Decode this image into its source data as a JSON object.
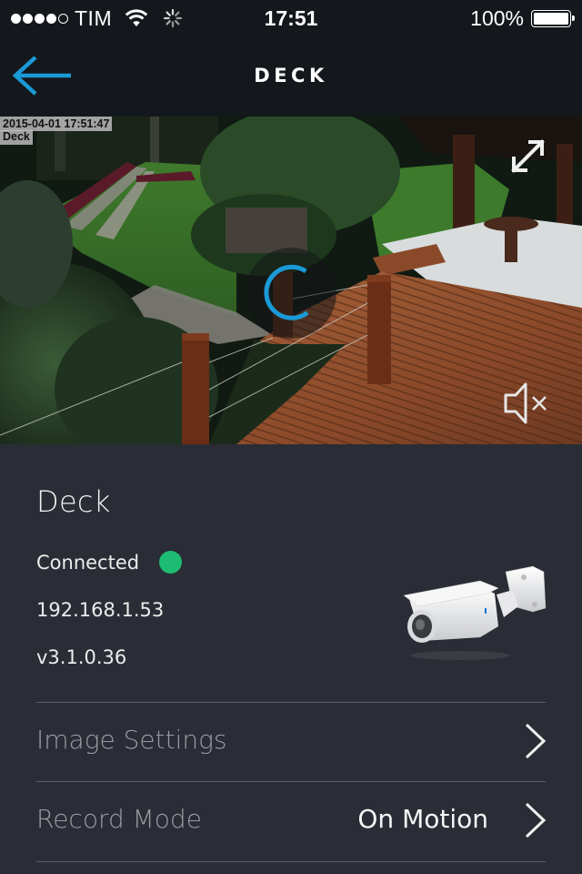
{
  "status_bar": {
    "signal_bars_filled": 4,
    "signal_bars_total": 5,
    "carrier": "TIM",
    "wifi_icon": "wifi-icon",
    "activity_icon": "activity-spinner-icon",
    "time": "17:51",
    "battery_percent": "100%",
    "battery_level": 1.0
  },
  "nav": {
    "title": "DECK",
    "back_icon": "arrow-left-icon"
  },
  "feed": {
    "timestamp": "2015-04-01 17:51:47",
    "camera_label": "Deck",
    "expand_icon": "expand-arrows-icon",
    "mute_icon": "speaker-muted-icon",
    "loading_icon": "loading-spinner-icon"
  },
  "details": {
    "name": "Deck",
    "status": "Connected",
    "ip": "192.168.1.53",
    "version": "v3.1.0.36",
    "camera_image": "bullet-camera-image"
  },
  "menu": [
    {
      "label": "Image Settings",
      "value": ""
    },
    {
      "label": "Record Mode",
      "value": "On Motion"
    }
  ],
  "colors": {
    "accent": "#1a9ad6",
    "status_connected": "#1dbc72",
    "panel_bg": "#2a2d35",
    "bar_bg": "#14181c",
    "divider": "#5a5e69",
    "menu_label": "#9a9ca3"
  }
}
